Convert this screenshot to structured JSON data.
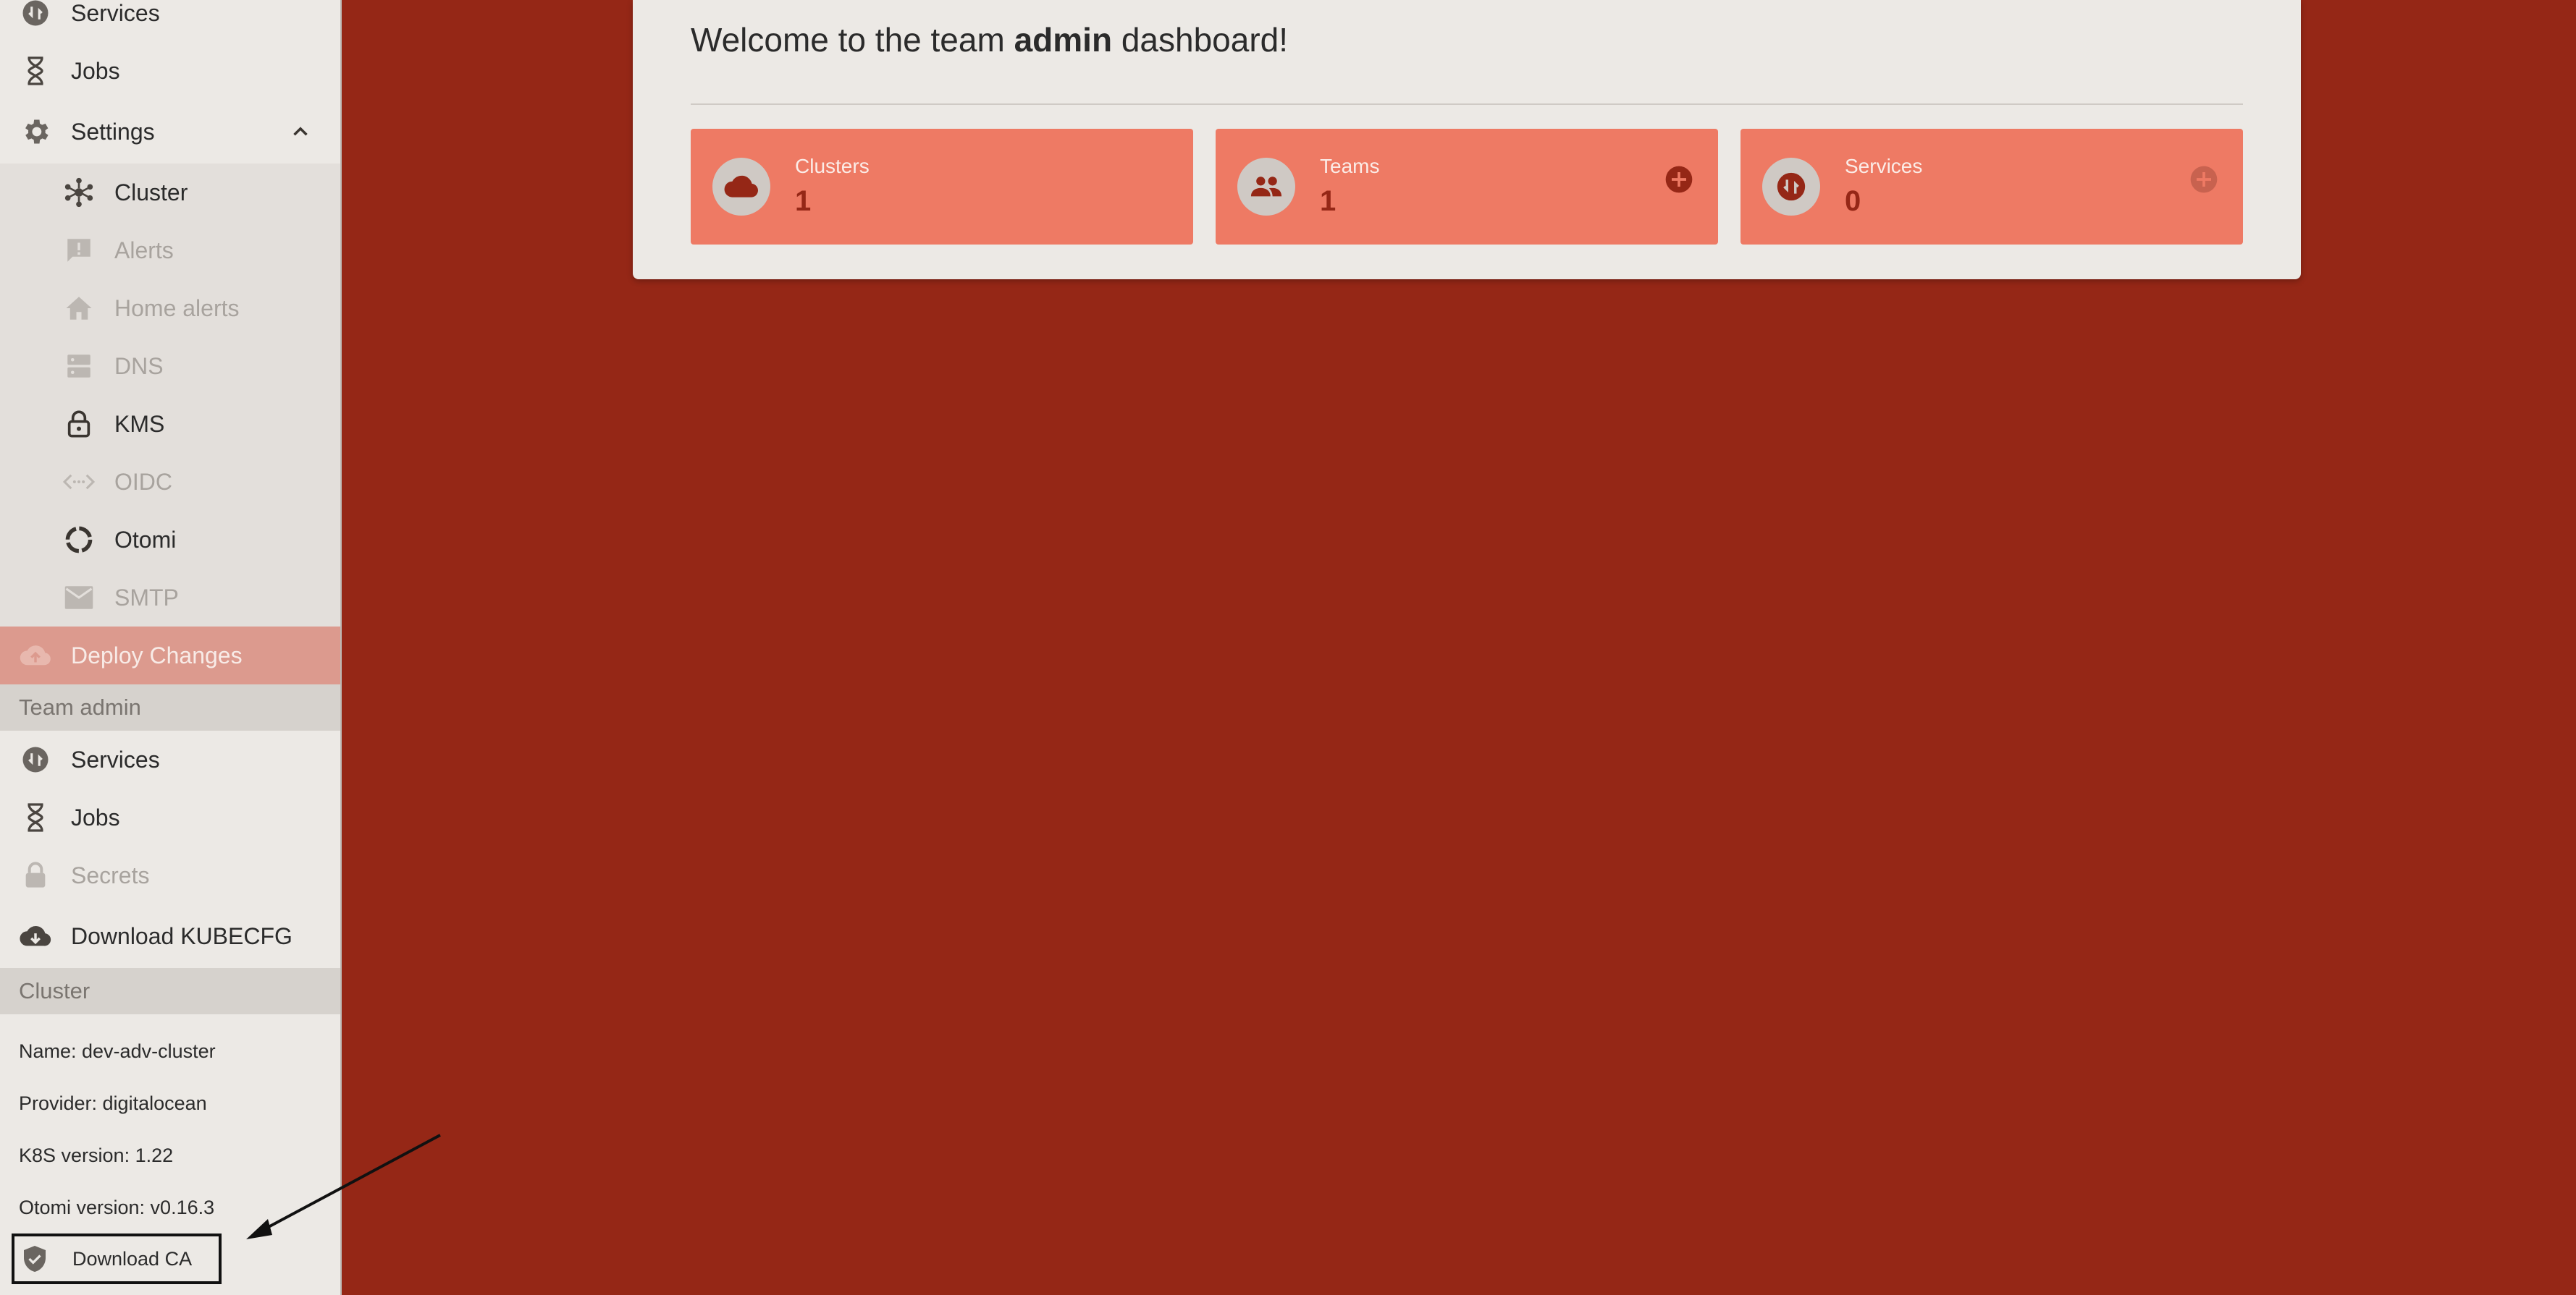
{
  "sidebar": {
    "top_items": [
      {
        "label": "Services",
        "icon": "services-icon"
      },
      {
        "label": "Jobs",
        "icon": "hourglass-icon"
      },
      {
        "label": "Settings",
        "icon": "gear-icon"
      }
    ],
    "settings_items": [
      {
        "label": "Cluster",
        "icon": "cluster-icon",
        "disabled": false
      },
      {
        "label": "Alerts",
        "icon": "alert-icon",
        "disabled": true
      },
      {
        "label": "Home alerts",
        "icon": "home-icon",
        "disabled": true
      },
      {
        "label": "DNS",
        "icon": "dns-icon",
        "disabled": true
      },
      {
        "label": "KMS",
        "icon": "lock-icon",
        "disabled": false
      },
      {
        "label": "OIDC",
        "icon": "code-icon",
        "disabled": true
      },
      {
        "label": "Otomi",
        "icon": "otomi-icon",
        "disabled": false
      },
      {
        "label": "SMTP",
        "icon": "mail-icon",
        "disabled": true
      }
    ],
    "deploy_label": "Deploy Changes",
    "team_section": "Team admin",
    "team_items": [
      {
        "label": "Services",
        "icon": "services-icon",
        "disabled": false
      },
      {
        "label": "Jobs",
        "icon": "hourglass-icon",
        "disabled": false
      },
      {
        "label": "Secrets",
        "icon": "lock-icon",
        "disabled": true
      }
    ],
    "download_kubecfg": "Download KUBECFG",
    "cluster_section": "Cluster",
    "cluster_info": {
      "name": "Name: dev-adv-cluster",
      "provider": "Provider: digitalocean",
      "k8s": "K8S version: 1.22",
      "otomi": "Otomi version: v0.16.3"
    },
    "download_ca": "Download CA"
  },
  "main": {
    "welcome_prefix": "Welcome to the team ",
    "welcome_team": "admin",
    "welcome_suffix": " dashboard!",
    "cards": [
      {
        "title": "Clusters",
        "value": "1",
        "icon": "cloud-icon",
        "has_add": false
      },
      {
        "title": "Teams",
        "value": "1",
        "icon": "people-icon",
        "has_add": true,
        "add_enabled": true
      },
      {
        "title": "Services",
        "value": "0",
        "icon": "services-icon",
        "has_add": true,
        "add_enabled": false
      }
    ]
  },
  "colors": {
    "background": "#952716",
    "card": "#ee7a64",
    "sidebar": "#ece9e5",
    "accent": "#952716"
  }
}
